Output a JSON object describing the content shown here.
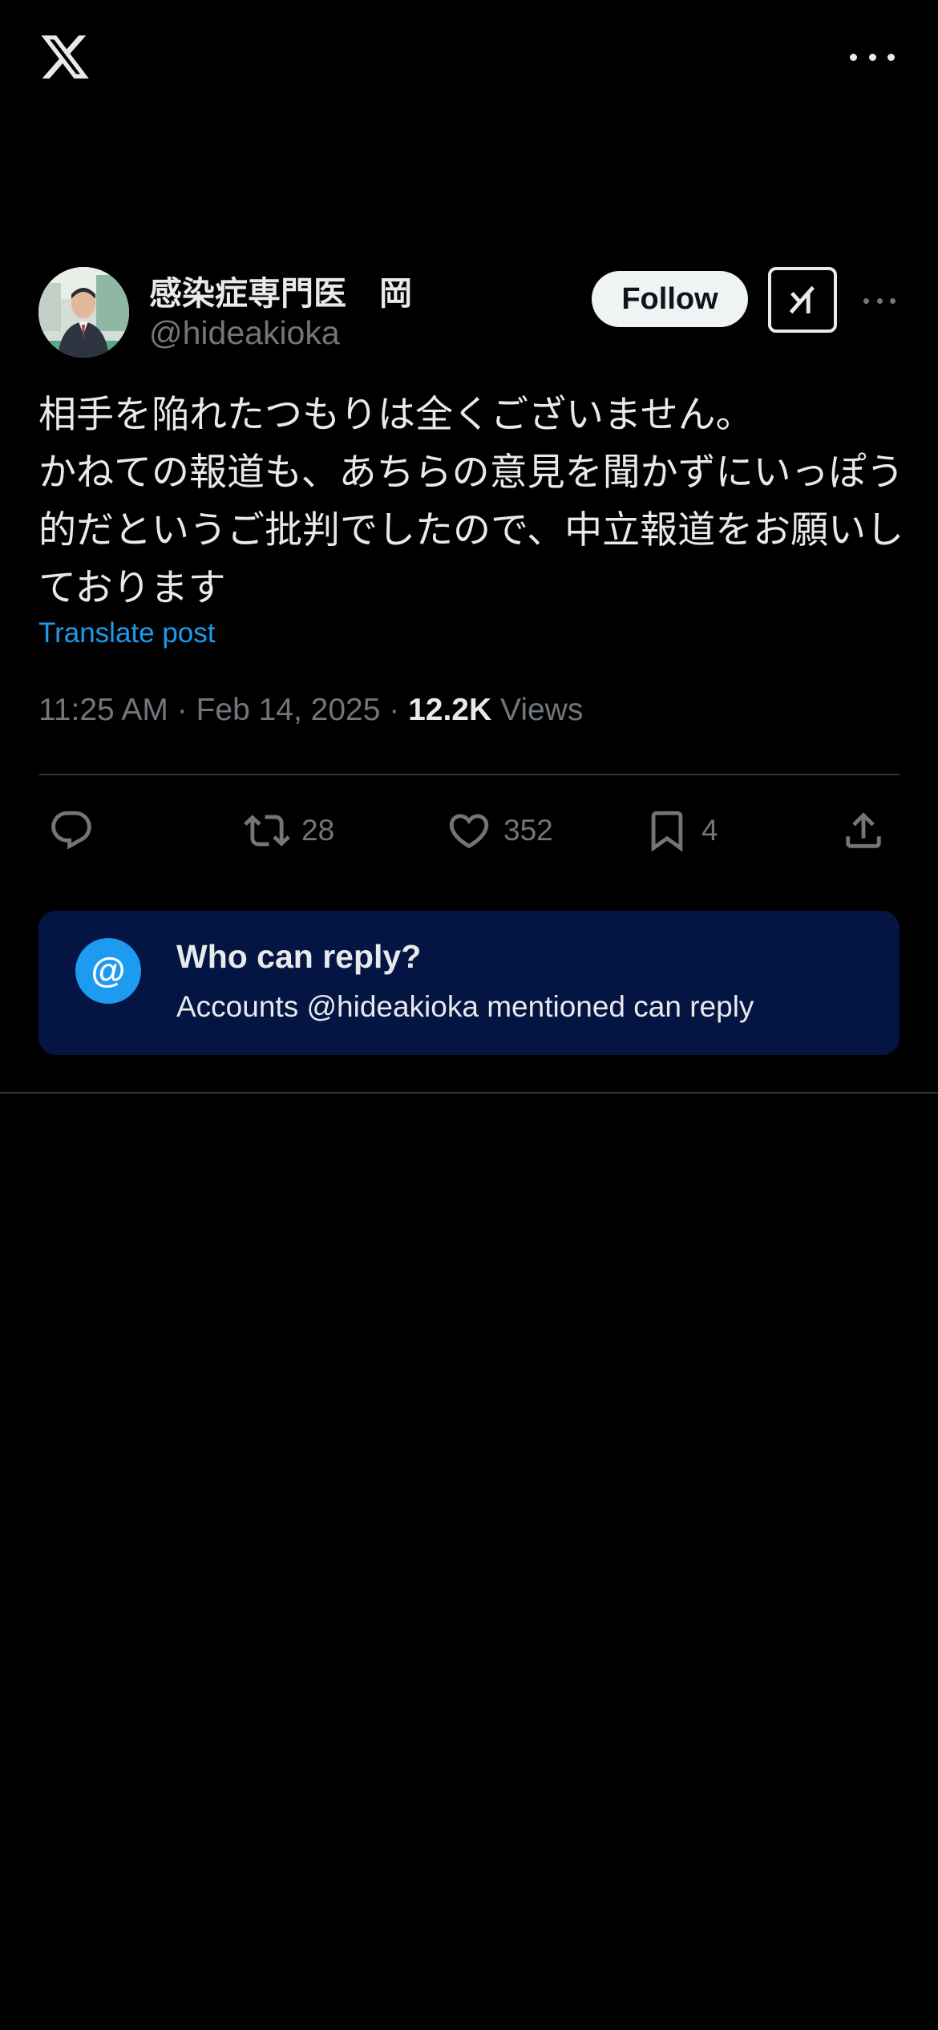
{
  "topbar": {
    "logo_icon": "x-logo-icon",
    "more_icon": "more-horizontal-icon"
  },
  "author": {
    "name": "感染症専門医　岡",
    "handle": "@hideakioka",
    "follow_label": "Follow",
    "grok_icon": "grok-icon",
    "more_icon": "more-horizontal-icon"
  },
  "tweet": {
    "text": "相手を陥れたつもりは全くございません。\nかねての報道も、あちらの意見を聞かずにいっぽう的だというご批判でしたので、中立報道をお願いしております",
    "translate_label": "Translate post",
    "time": "11:25 AM",
    "date": "Feb 14, 2025",
    "views_count": "12.2K",
    "views_label": "Views"
  },
  "actions": {
    "reply_icon": "reply-icon",
    "retweet_icon": "retweet-icon",
    "retweet_count": "28",
    "like_icon": "heart-icon",
    "like_count": "352",
    "bookmark_icon": "bookmark-icon",
    "bookmark_count": "4",
    "share_icon": "share-icon"
  },
  "reply_restriction": {
    "icon": "at-icon",
    "icon_glyph": "@",
    "title": "Who can reply?",
    "subtitle": "Accounts @hideakioka mentioned can reply"
  },
  "colors": {
    "background": "#000000",
    "text": "#e7e9ea",
    "muted": "#71767b",
    "accent": "#1d9bf0",
    "card": "#041543"
  }
}
